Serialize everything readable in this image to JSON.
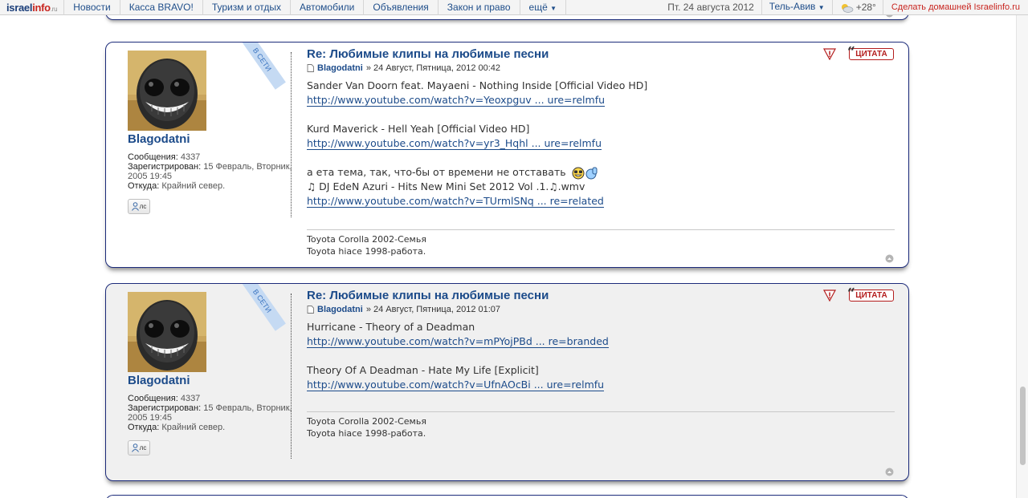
{
  "topbar": {
    "logo": {
      "main": "israel",
      "accent": "info",
      "tld": ".ru"
    },
    "nav": [
      {
        "label": "Новости",
        "name": "nav-news"
      },
      {
        "label": "Касса BRAVO!",
        "name": "nav-kassa-bravo"
      },
      {
        "label": "Туризм и отдых",
        "name": "nav-tourism"
      },
      {
        "label": "Автомобили",
        "name": "nav-cars"
      },
      {
        "label": "Объявления",
        "name": "nav-ads"
      },
      {
        "label": "Закон и право",
        "name": "nav-law"
      },
      {
        "label": "ещё",
        "name": "nav-more"
      }
    ],
    "date": "Пт. 24 августа 2012",
    "city": "Тель-Авив",
    "temperature": "+28°",
    "home_link": "Сделать домашней Israelinfo.ru",
    "accent_color": "#c8251f",
    "link_color": "#1f4e8a"
  },
  "posts": [
    {
      "status_ribbon": "В СЕТИ",
      "author": {
        "name": "Blagodatni",
        "posts_label": "Сообщения:",
        "posts_count": "4337",
        "registered_label": "Зарегистрирован:",
        "registered_value": "15 Февраль, Вторник, 2005 19:45",
        "from_label": "Откуда:",
        "from_value": "Крайний север.",
        "pm_label": "лс"
      },
      "title": "Re: Любимые клипы на любимые песни",
      "by": "Blagodatni",
      "datetime": "» 24 Август, Пятница, 2012 00:42",
      "quote_label": "ЦИТАТА",
      "lines": [
        {
          "text": "Sander Van Doorn feat. Mayaeni - Nothing Inside [Official Video HD]"
        },
        {
          "link": "http://www.youtube.com/watch?v=Yeoxpguv ... ure=relmfu"
        },
        {
          "gap": true
        },
        {
          "text": "Kurd Maverick - Hell Yeah [Official Video HD]"
        },
        {
          "link": "http://www.youtube.com/watch?v=yr3_Hqhl ... ure=relmfu"
        },
        {
          "gap": true
        },
        {
          "text": "а ета тема, так, что-бы от времени не отставать",
          "smilies": true
        },
        {
          "text": "♫ DJ EdeN Azuri - Hits New Mini Set 2012 Vol .1.♫.wmv"
        },
        {
          "link": "http://www.youtube.com/watch?v=TUrmlSNq ... re=related"
        }
      ],
      "signature": [
        "Toyota Corolla 2002-Семья",
        "Toyota hiace 1998-работа."
      ]
    },
    {
      "status_ribbon": "В СЕТИ",
      "author": {
        "name": "Blagodatni",
        "posts_label": "Сообщения:",
        "posts_count": "4337",
        "registered_label": "Зарегистрирован:",
        "registered_value": "15 Февраль, Вторник, 2005 19:45",
        "from_label": "Откуда:",
        "from_value": "Крайний север.",
        "pm_label": "лс"
      },
      "title": "Re: Любимые клипы на любимые песни",
      "by": "Blagodatni",
      "datetime": "» 24 Август, Пятница, 2012 01:07",
      "quote_label": "ЦИТАТА",
      "lines": [
        {
          "text": "Hurricane - Theory of a Deadman"
        },
        {
          "link": "http://www.youtube.com/watch?v=mPYojPBd ... re=branded"
        },
        {
          "gap": true
        },
        {
          "text": "Theory Of A Deadman - Hate My Life [Explicit]"
        },
        {
          "link": "http://www.youtube.com/watch?v=UfnAOcBi ... ure=relmfu"
        }
      ],
      "signature": [
        "Toyota Corolla 2002-Семья",
        "Toyota hiace 1998-работа."
      ]
    }
  ],
  "colors": {
    "frame_border": "#1c2b7a",
    "post_link": "#1c4b8a",
    "quote_red": "#b41d1d",
    "ribbon": "#c5daf3"
  }
}
